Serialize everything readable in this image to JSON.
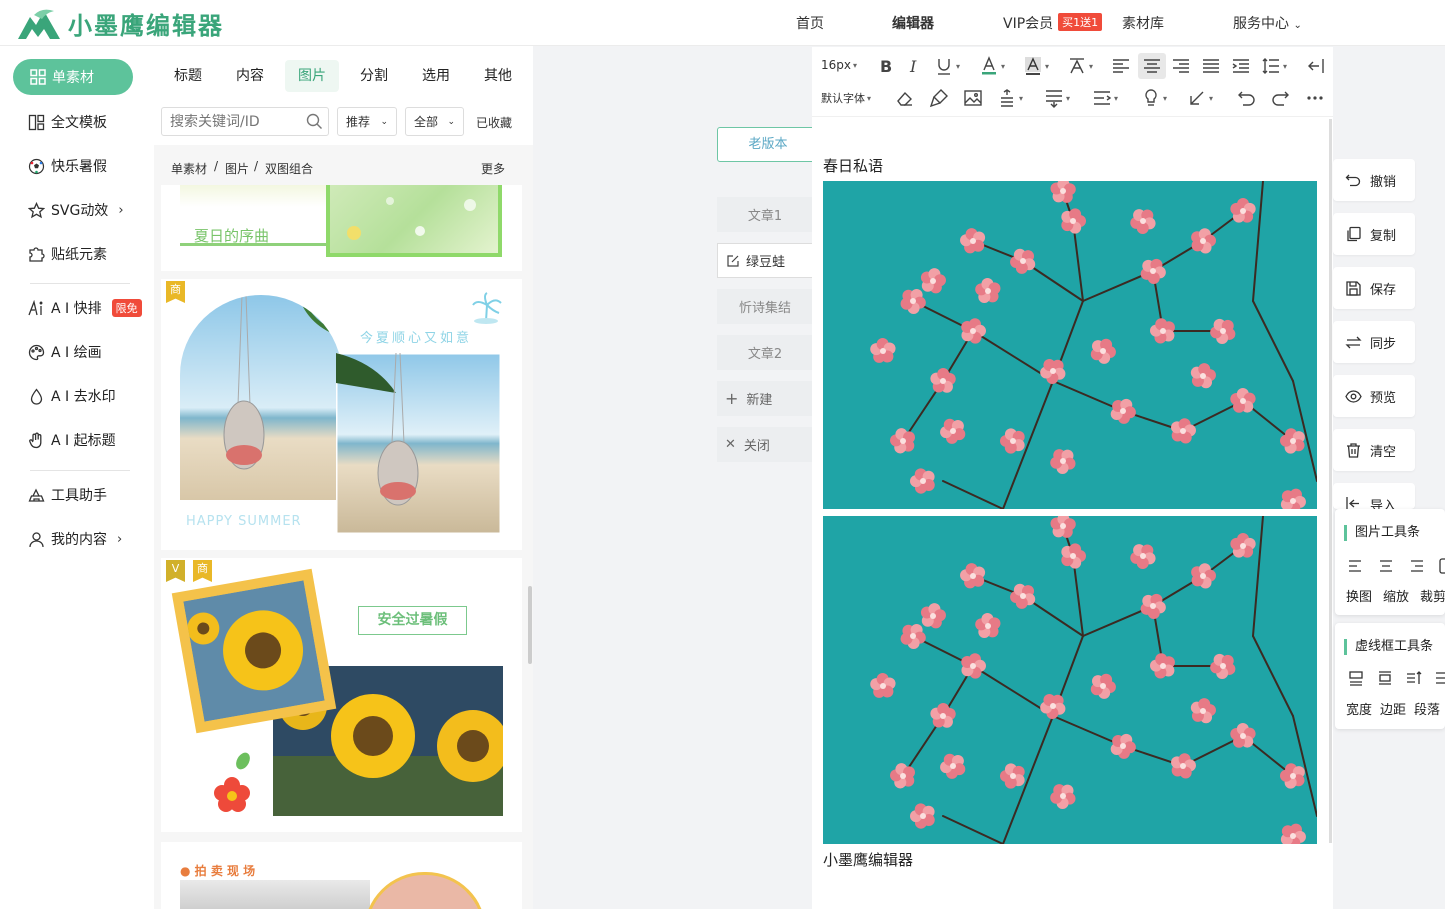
{
  "brand": {
    "name": "小墨鹰编辑器",
    "color": "#3aa57a"
  },
  "nav": {
    "home": "首页",
    "editor": "编辑器",
    "vip": "VIP会员",
    "vip_badge": "买1送1",
    "library": "素材库",
    "service": "服务中心"
  },
  "leftnav": {
    "active": "单素材",
    "items": [
      {
        "label": "全文模板",
        "icon": "template-icon"
      },
      {
        "label": "快乐暑假",
        "icon": "soccer-ball-icon"
      },
      {
        "label": "SVG动效",
        "icon": "star-icon"
      },
      {
        "label": "贴纸元素",
        "icon": "puzzle-icon"
      },
      {
        "label": "A I 快排",
        "icon": "ai-icon",
        "badge": "限免"
      },
      {
        "label": "A I 绘画",
        "icon": "palette-icon"
      },
      {
        "label": "A I 去水印",
        "icon": "drop-icon"
      },
      {
        "label": "A I 起标题",
        "icon": "hand-icon"
      },
      {
        "label": "工具助手",
        "icon": "tools-icon"
      },
      {
        "label": "我的内容",
        "icon": "user-icon"
      }
    ]
  },
  "panel": {
    "tabs": [
      "标题",
      "内容",
      "图片",
      "分割",
      "选用",
      "其他"
    ],
    "active_tab": "图片",
    "search_placeholder": "搜索关键词/ID",
    "sort": "推荐",
    "scope": "全部",
    "favorites": "已收藏",
    "breadcrumb": [
      "单素材",
      "图片",
      "双图组合"
    ],
    "more": "更多",
    "cards": [
      {
        "text": "夏日的序曲"
      },
      {
        "tag": "商",
        "text": "今夏顺心又如意",
        "footer": "HAPPY SUMMER"
      },
      {
        "tags": [
          "V",
          "商"
        ],
        "text": "安全过暑假"
      },
      {
        "text": "● 拍 卖 现 场"
      }
    ]
  },
  "articles": {
    "old_version": "老版本",
    "list": [
      "文章1",
      "绿豆蛙",
      "忻诗集结",
      "文章2"
    ],
    "new": "新建",
    "close": "关闭"
  },
  "editor": {
    "font_size": "16px",
    "font_family": "默认字体",
    "doc_title": "春日私语",
    "footer": "小墨鹰编辑器"
  },
  "right_tools": [
    "撤销",
    "复制",
    "保存",
    "同步",
    "预览",
    "清空",
    "导入"
  ],
  "img_toolbar": {
    "title": "图片工具条",
    "labels": [
      "换图",
      "缩放",
      "裁剪"
    ]
  },
  "dash_toolbar": {
    "title": "虚线框工具条",
    "labels": [
      "宽度",
      "边距",
      "段落"
    ]
  },
  "colors": {
    "accent": "#5dc39b",
    "badge_red": "#f04b3a",
    "sky": "#1fa4a6",
    "blossom": "#f2a0a6"
  }
}
